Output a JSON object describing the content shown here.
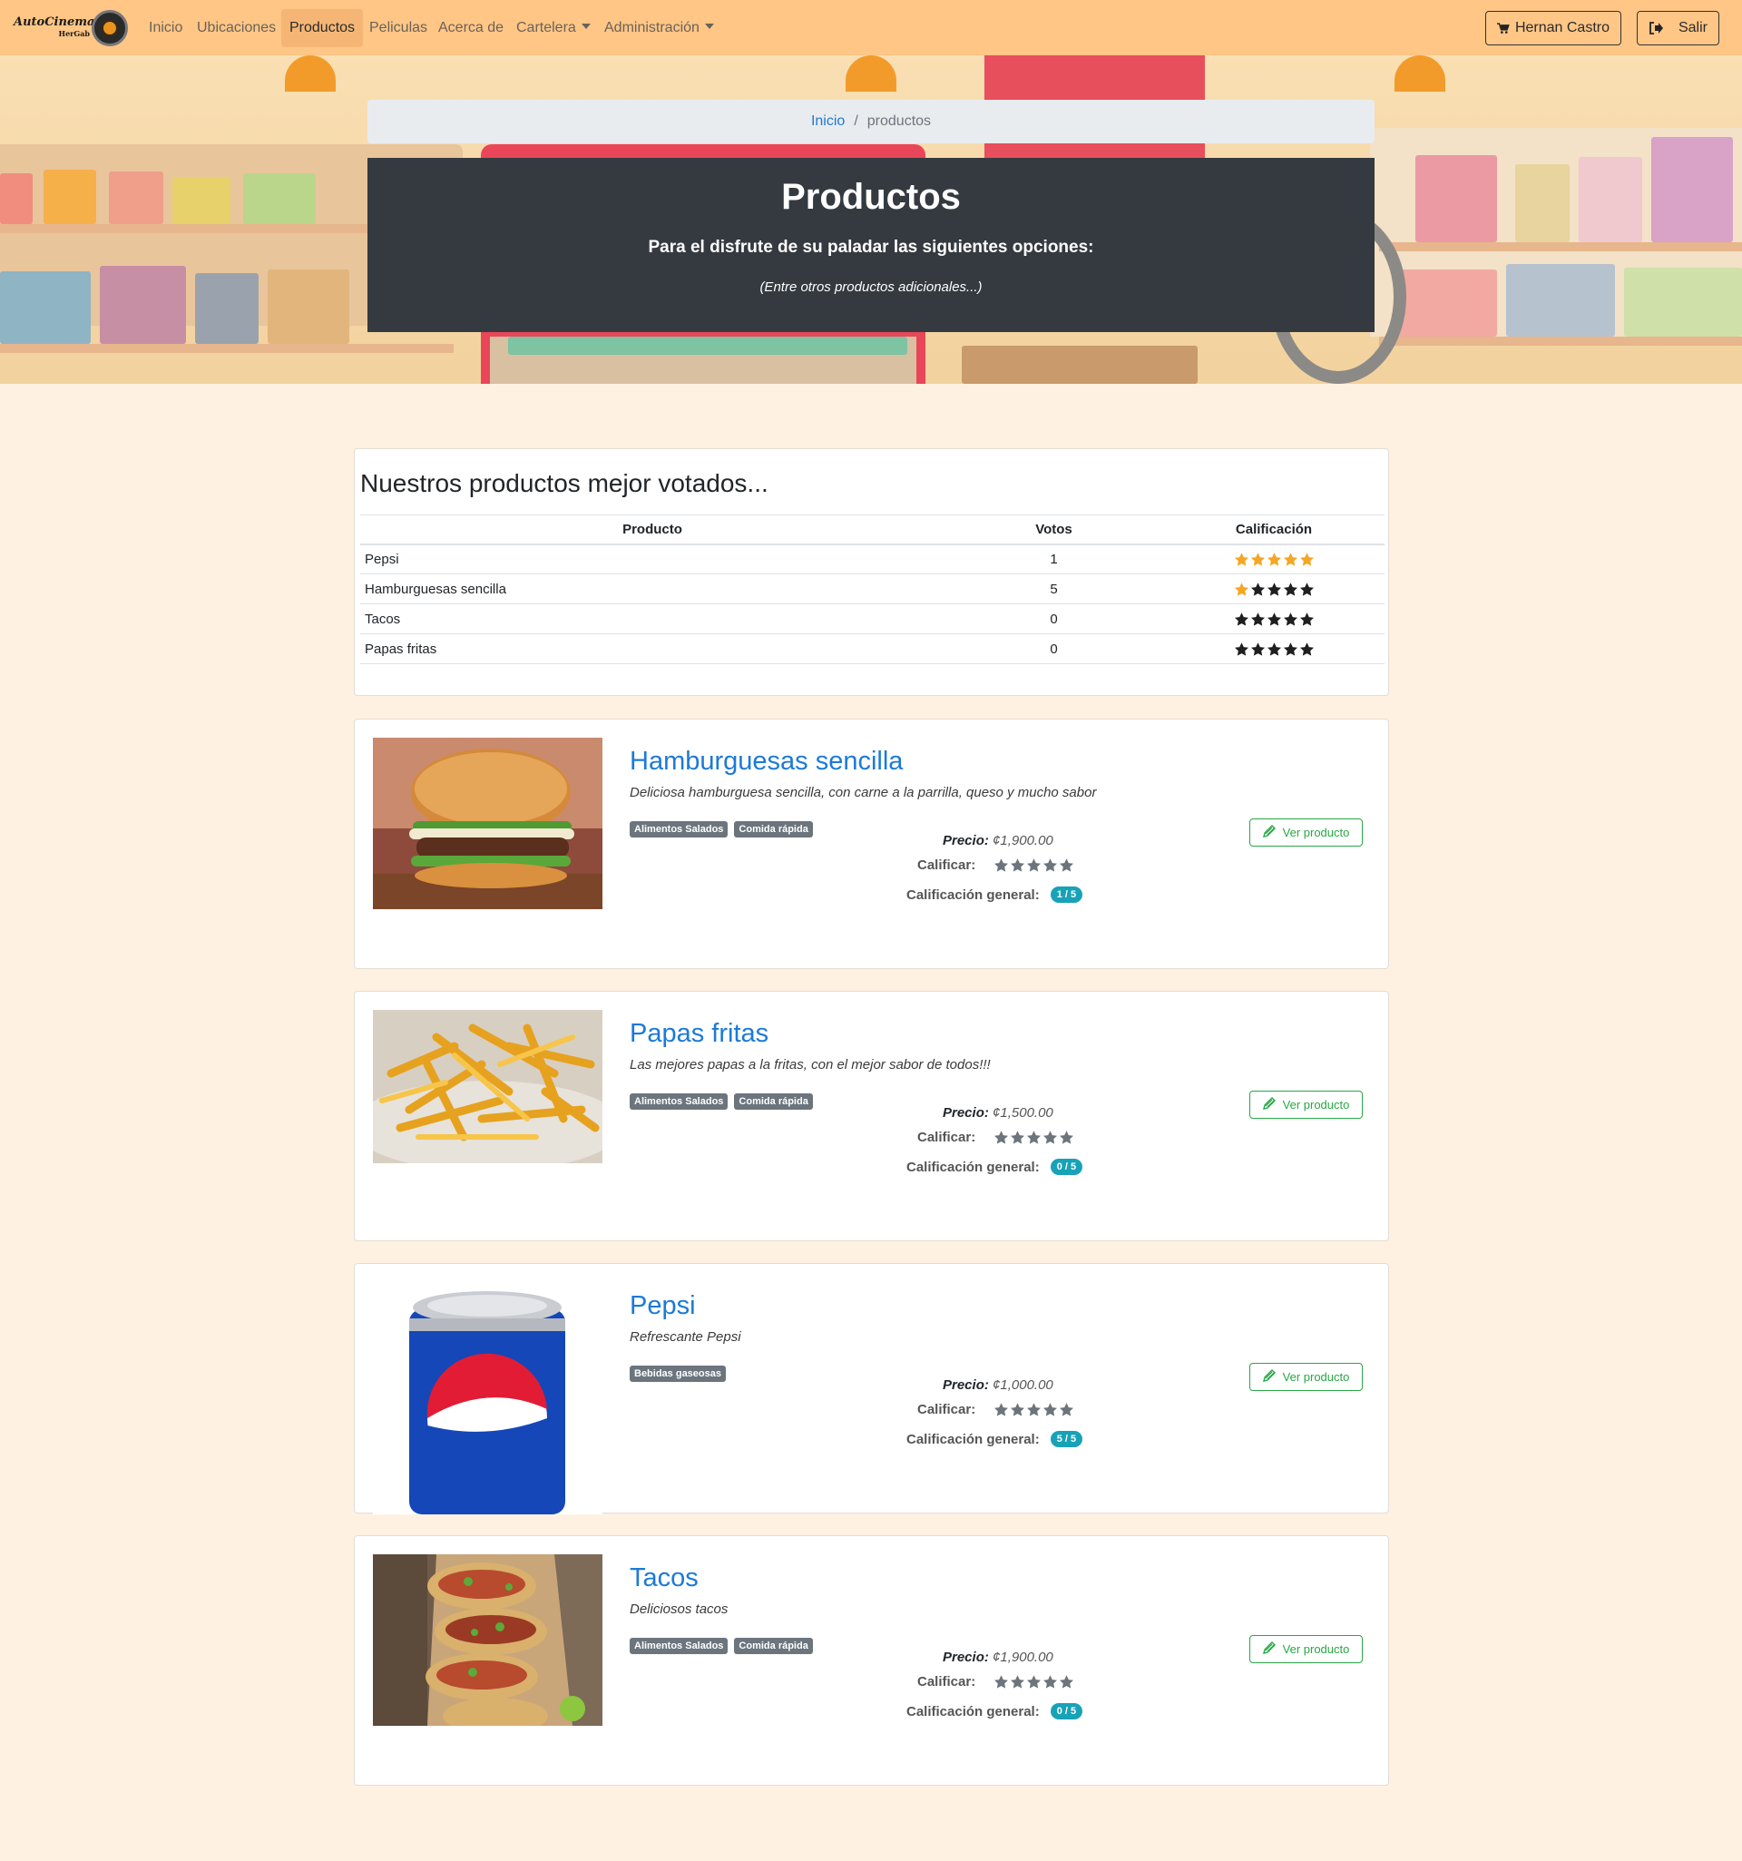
{
  "navbar": {
    "brand_name": "AutoCinema",
    "brand_sub": "HerGab",
    "links": [
      "Inicio",
      "Ubicaciones",
      "Productos",
      "Peliculas",
      "Acerca de",
      "Cartelera",
      "Administración"
    ],
    "user_label": "Hernan Castro",
    "logout_label": "Salir",
    "icons": {
      "cart": "shopping-cart-icon",
      "logout": "sign-out-icon"
    }
  },
  "breadcrumb": {
    "home": "Inicio",
    "separator": "/",
    "current": "productos"
  },
  "hero": {
    "title": "Productos",
    "lead": "Para el disfrute de su paladar las siguientes opciones:",
    "note": "(Entre otros productos adicionales...)"
  },
  "top_rated": {
    "heading": "Nuestros productos mejor votados...",
    "columns": [
      "Producto",
      "Votos",
      "Calificación"
    ],
    "rows": [
      {
        "name": "Pepsi",
        "votes": "1",
        "rating": 5
      },
      {
        "name": "Hamburguesas sencilla",
        "votes": "5",
        "rating": 1
      },
      {
        "name": "Tacos",
        "votes": "0",
        "rating": 0
      },
      {
        "name": "Papas fritas",
        "votes": "0",
        "rating": 0
      }
    ]
  },
  "labels": {
    "price": "Precio:",
    "rate": "Calificar:",
    "overall": "Calificación general:",
    "view": "Ver producto"
  },
  "products": [
    {
      "name": "Hamburguesas sencilla",
      "description": "Deliciosa hamburguesa sencilla, con carne a la parrilla, queso y mucho sabor",
      "tags": [
        "Alimentos Salados",
        "Comida rápida"
      ],
      "price": "¢1,900.00",
      "overall": "1 / 5"
    },
    {
      "name": "Papas fritas",
      "description": "Las mejores papas a la fritas, con el mejor sabor de todos!!!",
      "tags": [
        "Alimentos Salados",
        "Comida rápida"
      ],
      "price": "¢1,500.00",
      "overall": "0 / 5"
    },
    {
      "name": "Pepsi",
      "description": "Refrescante Pepsi",
      "tags": [
        "Bebidas gaseosas"
      ],
      "price": "¢1,000.00",
      "overall": "5 / 5"
    },
    {
      "name": "Tacos",
      "description": "Deliciosos tacos",
      "tags": [
        "Alimentos Salados",
        "Comida rápida"
      ],
      "price": "¢1,900.00",
      "overall": "0 / 5"
    }
  ],
  "colors": {
    "navbar": "#ffc686",
    "page_bg": "#fff1e1",
    "jumbotron": "#343a40",
    "link": "#1c7ad6",
    "star_filled": "#f5a623",
    "star_empty": "#1f1f1f",
    "badge_info": "#17a2b8",
    "success": "#28a745"
  }
}
